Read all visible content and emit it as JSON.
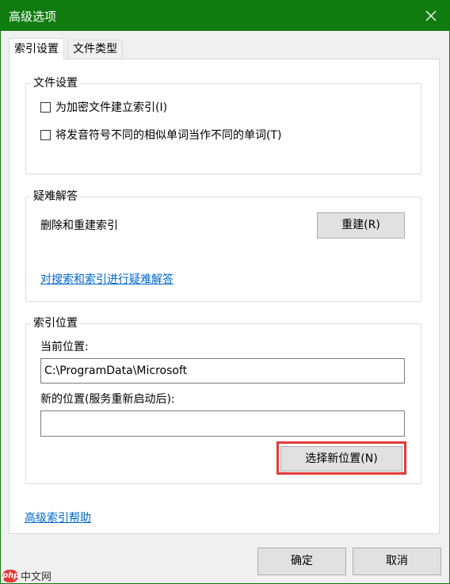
{
  "window": {
    "title": "高级选项"
  },
  "tabs": [
    {
      "label": "索引设置",
      "active": true
    },
    {
      "label": "文件类型",
      "active": false
    }
  ],
  "file_settings": {
    "legend": "文件设置",
    "options": [
      {
        "label": "为加密文件建立索引(I)",
        "checked": false
      },
      {
        "label": "将发音符号不同的相似单词当作不同的单词(T)",
        "checked": false
      }
    ]
  },
  "troubleshoot": {
    "legend": "疑难解答",
    "rebuild_label": "删除和重建索引",
    "rebuild_button": "重建(R)",
    "help_link": "对搜索和索引进行疑难解答"
  },
  "index_location": {
    "legend": "索引位置",
    "current_label": "当前位置:",
    "current_value": "C:\\ProgramData\\Microsoft",
    "new_label": "新的位置(服务重新启动后):",
    "new_value": "",
    "select_button": "选择新位置(N)"
  },
  "advanced_help_link": "高级索引帮助",
  "footer": {
    "ok": "确定",
    "cancel": "取消"
  },
  "watermark": {
    "logo": "php",
    "text": "中文网"
  },
  "colors": {
    "titlebar": "#107c10",
    "link": "#0066cc",
    "highlight": "#e33a3a"
  },
  "icons": {
    "close": "close-icon"
  }
}
